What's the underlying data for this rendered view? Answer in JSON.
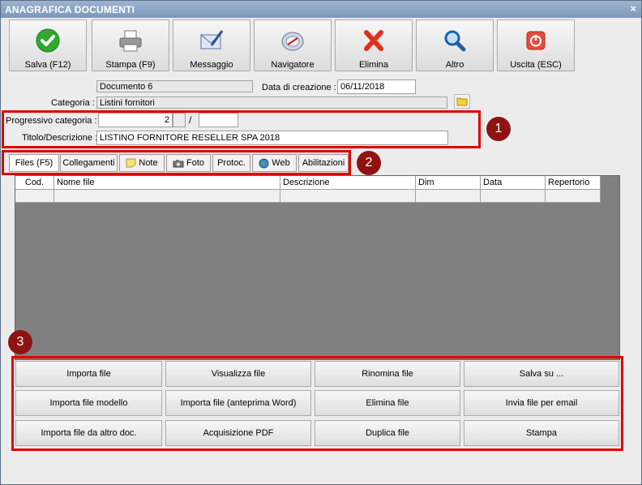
{
  "window": {
    "title": "ANAGRAFICA DOCUMENTI",
    "close": "×"
  },
  "toolbar": [
    {
      "label": "Salva (F12)",
      "icon": "check-icon"
    },
    {
      "label": "Stampa (F9)",
      "icon": "printer-icon"
    },
    {
      "label": "Messaggio",
      "icon": "mail-icon"
    },
    {
      "label": "Navigatore",
      "icon": "compass-icon"
    },
    {
      "label": "Elimina",
      "icon": "delete-x-icon"
    },
    {
      "label": "Altro",
      "icon": "magnifier-icon"
    },
    {
      "label": "Uscita (ESC)",
      "icon": "power-icon"
    }
  ],
  "form": {
    "document_name": "Documento 6",
    "creation_date_label": "Data di creazione :",
    "creation_date": "06/11/2018",
    "category_label": "Categoria :",
    "category": "Listini fornitori",
    "progressive_label": "Progressivo categoria :",
    "progressive_value": "2",
    "progressive_sep": "/",
    "progressive_suffix": "",
    "title_label": "Titolo/Descrizione :",
    "title_value": "LISTINO FORNITORE RESELLER SPA 2018"
  },
  "badges": {
    "one": "1",
    "two": "2",
    "three": "3"
  },
  "tabs": [
    {
      "label": "Files (F5)",
      "icon": ""
    },
    {
      "label": "Collegamenti",
      "icon": ""
    },
    {
      "label": "Note",
      "icon": "note-icon"
    },
    {
      "label": "Foto",
      "icon": "camera-icon"
    },
    {
      "label": "Protoc.",
      "icon": ""
    },
    {
      "label": "Web",
      "icon": "globe-icon"
    },
    {
      "label": "Abilitazioni",
      "icon": ""
    }
  ],
  "grid": {
    "columns": [
      "Cod.",
      "Nome file",
      "Descrizione",
      "Dim",
      "Data",
      "Repertorio"
    ]
  },
  "actions": [
    "Importa file",
    "Visualizza file",
    "Rinomina file",
    "Salva su ...",
    "Importa file modello",
    "Importa file (anteprima Word)",
    "Elimina file",
    "Invia file per email",
    "Importa file da altro doc.",
    "Acquisizione PDF",
    "Duplica file",
    "Stampa"
  ],
  "colors": {
    "accent_red": "#e00000",
    "badge": "#8e1414",
    "title_bar": "#8aa3c4"
  }
}
